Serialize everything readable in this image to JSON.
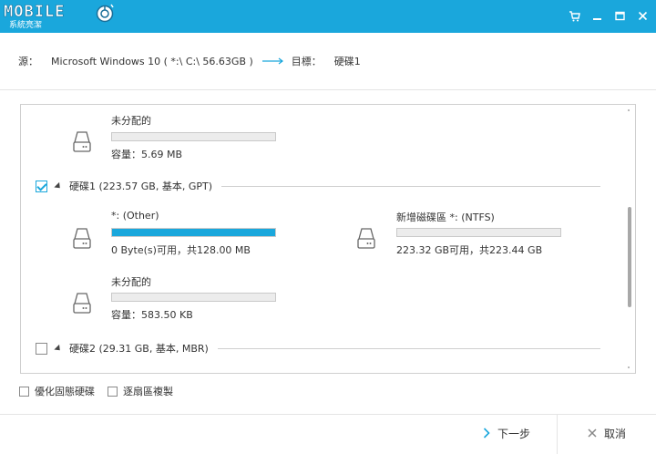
{
  "app": {
    "logo_text": "MOBILE",
    "logo_subtitle": "系統亮潔"
  },
  "path": {
    "source_label": "源：",
    "source_value": "Microsoft Windows 10 ( *:\\ C:\\   56.63GB )",
    "target_label": "目標：",
    "target_value": "硬碟1"
  },
  "partitions": {
    "top_unallocated": {
      "name": "未分配的",
      "info": "容量：5.69 MB",
      "used_fraction": 0
    },
    "disk1_other": {
      "name": "*: (Other)",
      "info": "0 Byte(s)可用，共128.00 MB",
      "used_fraction": 1.0
    },
    "disk1_ntfs": {
      "name": "新增磁碟區 *: (NTFS)",
      "info": "223.32 GB可用，共223.44 GB",
      "used_fraction": 0.0
    },
    "disk1_unallocated": {
      "name": "未分配的",
      "info": "容量：583.50 KB",
      "used_fraction": 0
    }
  },
  "disks": [
    {
      "label": "硬碟1 (223.57 GB, 基本, GPT)",
      "checked": true
    },
    {
      "label": "硬碟2 (29.31 GB, 基本, MBR)",
      "checked": false
    }
  ],
  "options": {
    "optimize_ssd": "優化固態硬碟",
    "sector_copy": "逐扇區複製"
  },
  "buttons": {
    "next": "下一步",
    "cancel": "取消"
  },
  "colors": {
    "accent": "#1aa7dc"
  }
}
